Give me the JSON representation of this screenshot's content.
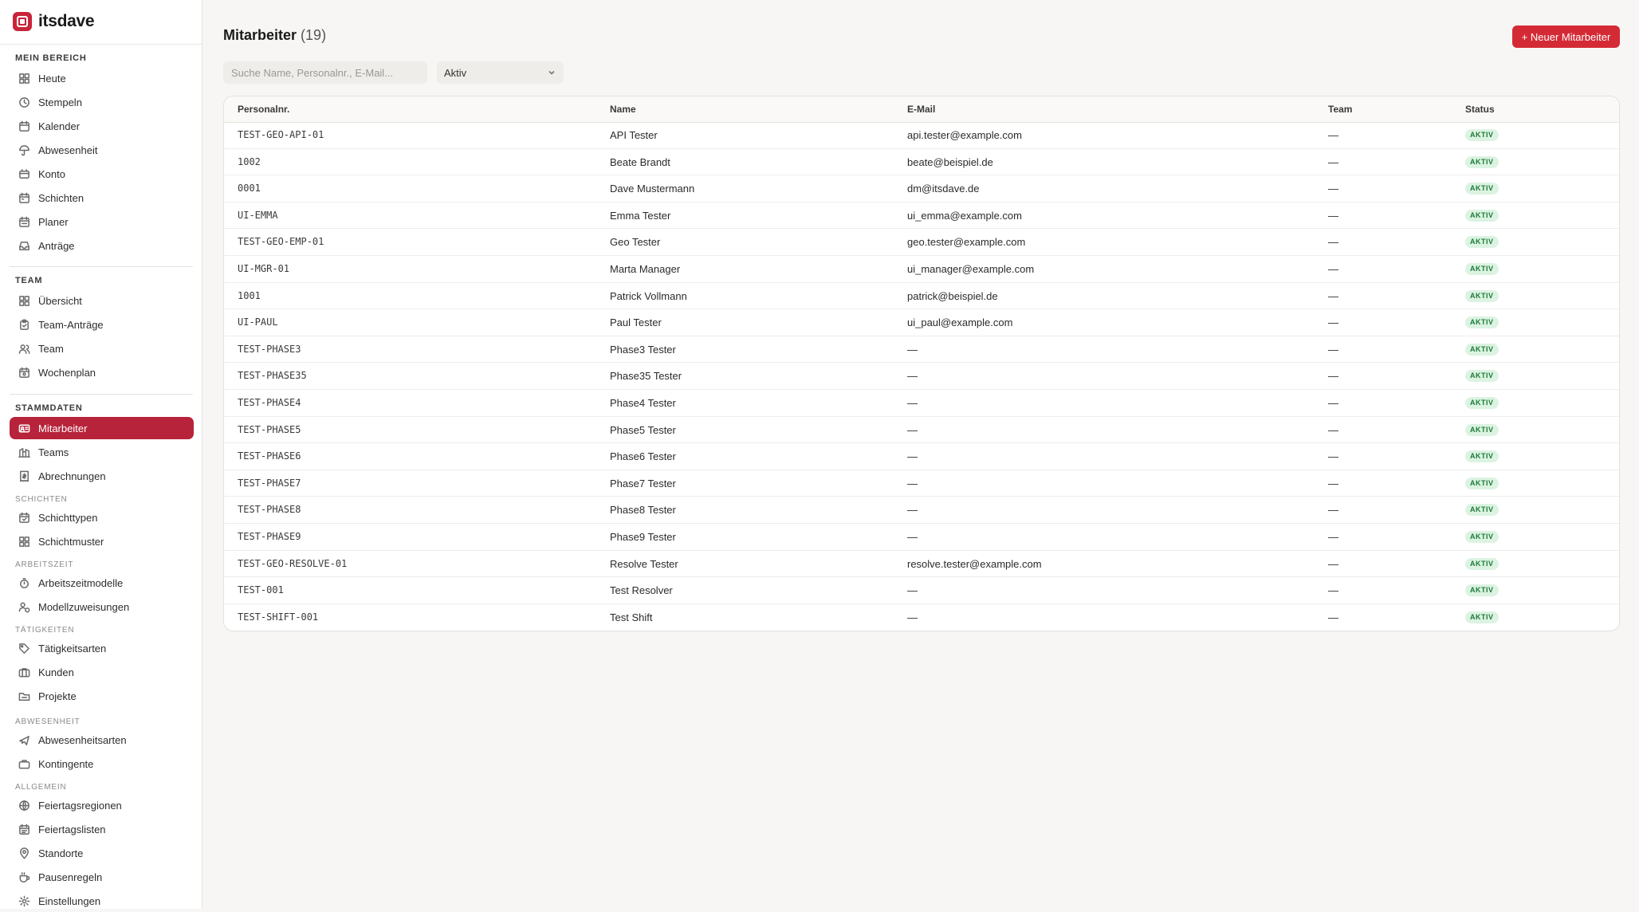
{
  "brand": {
    "name": "itsdave"
  },
  "sidebar": {
    "sections": [
      {
        "heading": "MEIN BEREICH",
        "items": [
          {
            "label": "Heute",
            "icon": "dashboard-icon"
          },
          {
            "label": "Stempeln",
            "icon": "clock-icon"
          },
          {
            "label": "Kalender",
            "icon": "calendar-icon"
          },
          {
            "label": "Abwesenheit",
            "icon": "umbrella-icon"
          },
          {
            "label": "Konto",
            "icon": "account-icon"
          },
          {
            "label": "Schichten",
            "icon": "calendar-shift-icon"
          },
          {
            "label": "Planer",
            "icon": "planner-icon"
          },
          {
            "label": "Anträge",
            "icon": "inbox-icon"
          }
        ]
      },
      {
        "heading": "TEAM",
        "items": [
          {
            "label": "Übersicht",
            "icon": "dashboard-icon"
          },
          {
            "label": "Team-Anträge",
            "icon": "clipboard-icon"
          },
          {
            "label": "Team",
            "icon": "users-icon"
          },
          {
            "label": "Wochenplan",
            "icon": "calendar-week-icon"
          }
        ]
      },
      {
        "heading": "STAMMDATEN",
        "items": [
          {
            "label": "Mitarbeiter",
            "icon": "id-card-icon",
            "active": true
          },
          {
            "label": "Teams",
            "icon": "building-icon"
          },
          {
            "label": "Abrechnungen",
            "icon": "receipt-icon"
          }
        ]
      }
    ],
    "subsections": [
      {
        "heading": "SCHICHTEN",
        "items": [
          {
            "label": "Schichttypen",
            "icon": "calendar-check-icon"
          },
          {
            "label": "Schichtmuster",
            "icon": "grid-icon"
          }
        ]
      },
      {
        "heading": "ARBEITSZEIT",
        "items": [
          {
            "label": "Arbeitszeitmodelle",
            "icon": "timer-icon"
          },
          {
            "label": "Modellzuweisungen",
            "icon": "user-assign-icon"
          }
        ]
      },
      {
        "heading": "TÄTIGKEITEN",
        "items": [
          {
            "label": "Tätigkeitsarten",
            "icon": "tag-icon"
          },
          {
            "label": "Kunden",
            "icon": "briefcase-icon"
          },
          {
            "label": "Projekte",
            "icon": "folder-icon"
          }
        ]
      },
      {
        "heading": "ABWESENHEIT",
        "items": [
          {
            "label": "Abwesenheitsarten",
            "icon": "plane-icon"
          },
          {
            "label": "Kontingente",
            "icon": "suitcase-icon"
          }
        ]
      },
      {
        "heading": "ALLGEMEIN",
        "items": [
          {
            "label": "Feiertagsregionen",
            "icon": "globe-icon"
          },
          {
            "label": "Feiertagslisten",
            "icon": "calendar-list-icon"
          },
          {
            "label": "Standorte",
            "icon": "map-pin-icon"
          },
          {
            "label": "Pausenregeln",
            "icon": "coffee-icon"
          },
          {
            "label": "Einstellungen",
            "icon": "gear-icon"
          }
        ]
      }
    ]
  },
  "header": {
    "title": "Mitarbeiter",
    "count": "(19)",
    "new_button": "+ Neuer Mitarbeiter"
  },
  "filters": {
    "search_placeholder": "Suche Name, Personalnr., E-Mail...",
    "status_value": "Aktiv"
  },
  "table": {
    "columns": [
      "Personalnr.",
      "Name",
      "E-Mail",
      "Team",
      "Status"
    ],
    "rows": [
      [
        "TEST-GEO-API-01",
        "API Tester",
        "api.tester@example.com",
        "—",
        "AKTIV"
      ],
      [
        "1002",
        "Beate Brandt",
        "beate@beispiel.de",
        "—",
        "AKTIV"
      ],
      [
        "0001",
        "Dave Mustermann",
        "dm@itsdave.de",
        "—",
        "AKTIV"
      ],
      [
        "UI-EMMA",
        "Emma Tester",
        "ui_emma@example.com",
        "—",
        "AKTIV"
      ],
      [
        "TEST-GEO-EMP-01",
        "Geo Tester",
        "geo.tester@example.com",
        "—",
        "AKTIV"
      ],
      [
        "UI-MGR-01",
        "Marta Manager",
        "ui_manager@example.com",
        "—",
        "AKTIV"
      ],
      [
        "1001",
        "Patrick Vollmann",
        "patrick@beispiel.de",
        "—",
        "AKTIV"
      ],
      [
        "UI-PAUL",
        "Paul Tester",
        "ui_paul@example.com",
        "—",
        "AKTIV"
      ],
      [
        "TEST-PHASE3",
        "Phase3 Tester",
        "—",
        "—",
        "AKTIV"
      ],
      [
        "TEST-PHASE35",
        "Phase35 Tester",
        "—",
        "—",
        "AKTIV"
      ],
      [
        "TEST-PHASE4",
        "Phase4 Tester",
        "—",
        "—",
        "AKTIV"
      ],
      [
        "TEST-PHASE5",
        "Phase5 Tester",
        "—",
        "—",
        "AKTIV"
      ],
      [
        "TEST-PHASE6",
        "Phase6 Tester",
        "—",
        "—",
        "AKTIV"
      ],
      [
        "TEST-PHASE7",
        "Phase7 Tester",
        "—",
        "—",
        "AKTIV"
      ],
      [
        "TEST-PHASE8",
        "Phase8 Tester",
        "—",
        "—",
        "AKTIV"
      ],
      [
        "TEST-PHASE9",
        "Phase9 Tester",
        "—",
        "—",
        "AKTIV"
      ],
      [
        "TEST-GEO-RESOLVE-01",
        "Resolve Tester",
        "resolve.tester@example.com",
        "—",
        "AKTIV"
      ],
      [
        "TEST-001",
        "Test Resolver",
        "—",
        "—",
        "AKTIV"
      ],
      [
        "TEST-SHIFT-001",
        "Test Shift",
        "—",
        "—",
        "AKTIV"
      ]
    ]
  },
  "colors": {
    "accent": "#b7233a",
    "button": "#d42a35",
    "badge_bg": "#dcf3e2",
    "badge_text": "#1d7a3a"
  }
}
